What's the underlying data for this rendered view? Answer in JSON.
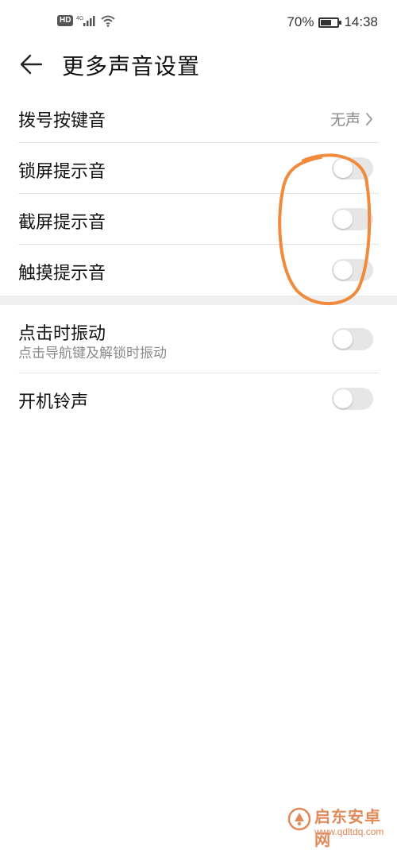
{
  "status_bar": {
    "hd_badge": "HD",
    "network": "4G",
    "battery_percent": "70%",
    "battery_level": 0.7,
    "time": "14:38"
  },
  "header": {
    "title": "更多声音设置",
    "back_icon": "arrow-left-icon"
  },
  "settings": [
    {
      "label": "拨号按键音",
      "value": "无声",
      "control": "chevron"
    },
    {
      "label": "锁屏提示音",
      "control": "toggle",
      "on": false
    },
    {
      "label": "截屏提示音",
      "control": "toggle",
      "on": false
    },
    {
      "label": "触摸提示音",
      "control": "toggle",
      "on": false
    },
    {
      "label": "点击时振动",
      "sublabel": "点击导航键及解锁时振动",
      "control": "toggle",
      "on": false
    },
    {
      "label": "开机铃声",
      "control": "toggle",
      "on": false
    }
  ],
  "annotation": {
    "color": "#f08a3c",
    "shape": "hand-drawn ellipse around toggles"
  },
  "watermark": {
    "title": "启东安卓网",
    "url": "www.qdltdq.com",
    "color": "#e08a5a"
  }
}
